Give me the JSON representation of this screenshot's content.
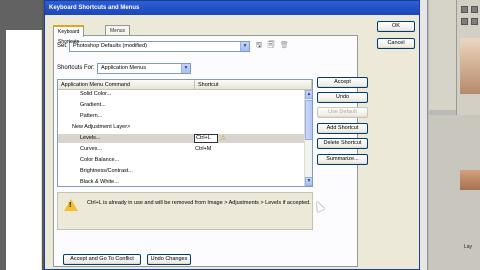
{
  "window": {
    "title": "Keyboard Shortcuts and Menus"
  },
  "tabs": [
    {
      "label": "Keyboard Shortcuts"
    },
    {
      "label": "Menus"
    }
  ],
  "set": {
    "label": "Set:",
    "value": "Photoshop Defaults (modified)"
  },
  "shortcuts_for": {
    "label": "Shortcuts For:",
    "value": "Application Menus"
  },
  "table": {
    "columns": [
      "Application Menu Command",
      "Shortcut"
    ],
    "rows": [
      {
        "command": "Solid Color...",
        "shortcut": ""
      },
      {
        "command": "Gradient...",
        "shortcut": ""
      },
      {
        "command": "Pattern...",
        "shortcut": ""
      },
      {
        "command": "New Adjustment Layer>",
        "shortcut": ""
      },
      {
        "command": "Levels...",
        "shortcut": "Ctrl+L"
      },
      {
        "command": "Curves...",
        "shortcut": "Ctrl+M"
      },
      {
        "command": "Color Balance...",
        "shortcut": ""
      },
      {
        "command": "Brightness/Contrast...",
        "shortcut": ""
      },
      {
        "command": "Black & White...",
        "shortcut": ""
      }
    ]
  },
  "buttons": {
    "ok": "OK",
    "cancel": "Cancel",
    "accept": "Accept",
    "undo": "Undo",
    "use_default": "Use Default",
    "add_shortcut": "Add Shortcut",
    "delete_shortcut": "Delete Shortcut",
    "summarize": "Summarize...",
    "accept_goto": "Accept and Go To Conflict",
    "undo_changes": "Undo Changes"
  },
  "message": "Ctrl+L is already in use and will be removed from Image > Adjustments > Levels if accepted.",
  "background": {
    "layers_label": "Lay"
  },
  "colors": {
    "title_bar": "#1c46b8",
    "dialog_bg": "#ece9d8",
    "warning": "#f2c12e"
  }
}
